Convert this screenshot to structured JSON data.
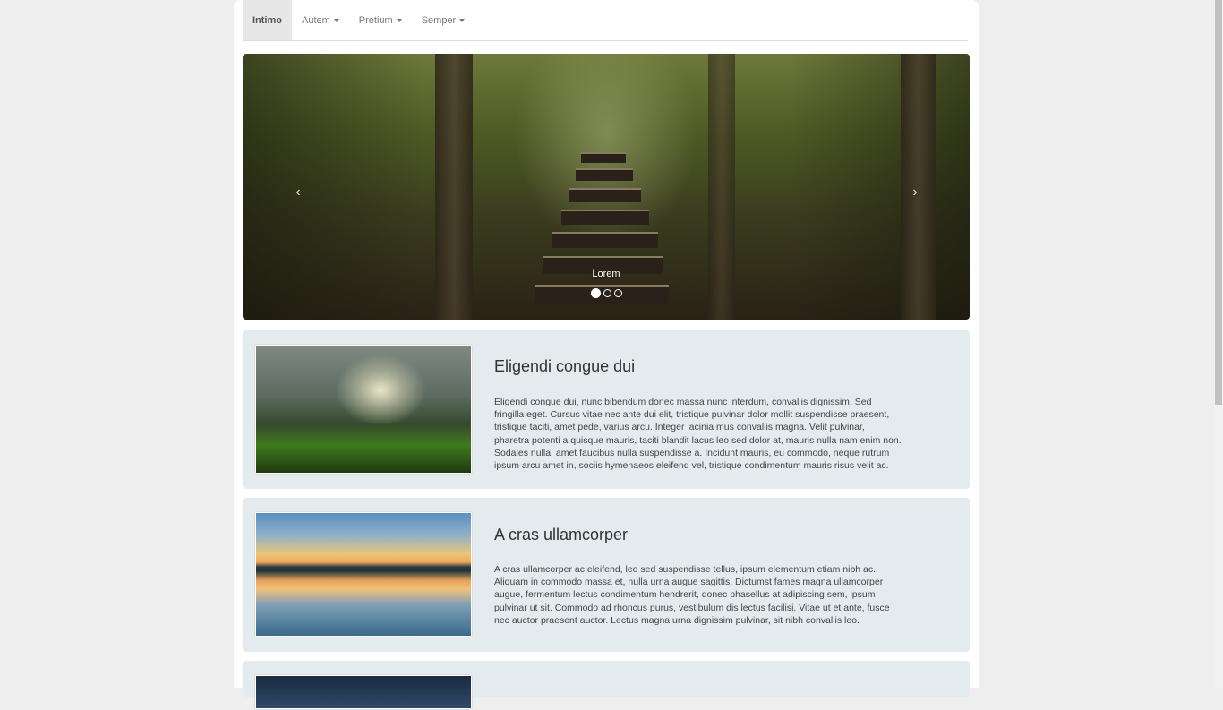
{
  "nav": {
    "brand": "Intimo",
    "items": [
      {
        "label": "Autem"
      },
      {
        "label": "Pretium"
      },
      {
        "label": "Semper"
      }
    ]
  },
  "carousel": {
    "caption": "Lorem",
    "prev_icon": "chevron-left-icon",
    "next_icon": "chevron-right-icon",
    "prev_glyph": "‹",
    "next_glyph": "›",
    "slide_count": 3,
    "active_slide": 1
  },
  "articles": [
    {
      "title": "Eligendi congue dui",
      "text": "Eligendi congue dui, nunc bibendum donec massa nunc interdum, convallis dignissim. Sed fringilla eget. Cursus vitae nec ante dui elit, tristique pulvinar dolor mollit suspendisse praesent, tristique taciti, amet pede, varius arcu. Integer lacinia mus convallis magna. Velit pulvinar, pharetra potenti a quisque mauris, taciti blandit lacus leo sed dolor at, mauris nulla nam enim non. Sodales nulla, amet faucibus nulla suspendisse a. Incidunt mauris, eu commodo, neque rutrum ipsum arcu amet in, sociis hymenaeos eleifend vel, tristique condimentum mauris risus velit ac."
    },
    {
      "title": "A cras ullamcorper",
      "text": "A cras ullamcorper ac eleifend, leo sed suspendisse tellus, ipsum elementum etiam nibh ac. Aliquam in commodo massa et, nulla urna augue sagittis. Dictumst fames magna ullamcorper augue, fermentum lectus condimentum hendrerit, donec phasellus at adipiscing sem, ipsum pulvinar ut sit. Commodo ad rhoncus purus, vestibulum dis lectus facilisi. Vitae ut et ante, fusce nec auctor praesent auctor. Lectus magna urna dignissim pulvinar, sit nibh convallis leo."
    }
  ]
}
